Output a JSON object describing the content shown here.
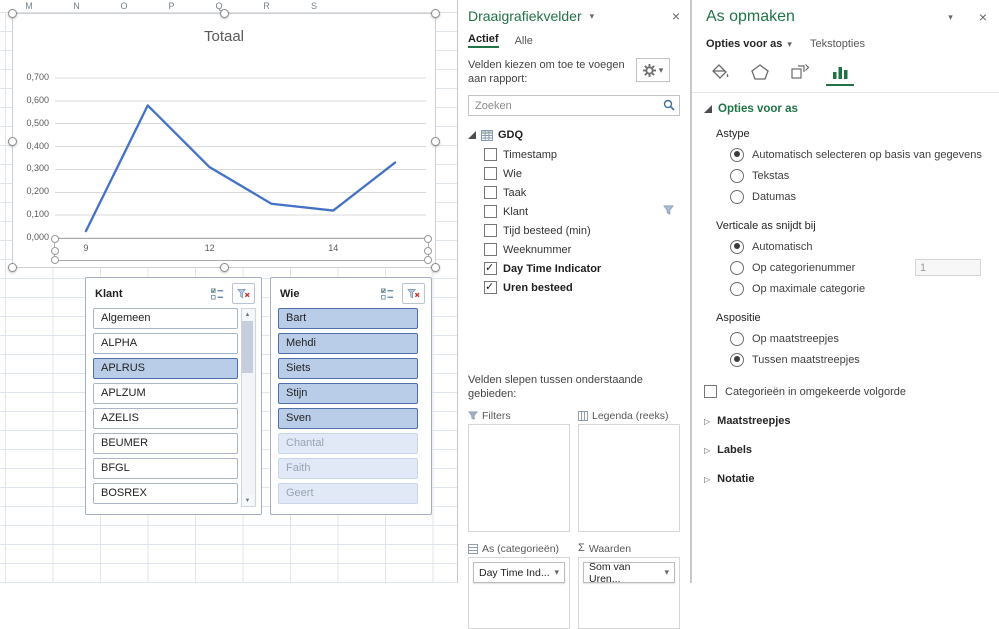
{
  "glyphs": {
    "close": "×",
    "caret": "▾",
    "collapsed": "▷",
    "sigma": "Σ",
    "up_arrow": "▲",
    "down_arrow": "▼"
  },
  "colors": {
    "accent_green": "#217346",
    "line_blue": "#4472C4"
  },
  "spreadsheet": {
    "column_headers": [
      "M",
      "N",
      "O",
      "P",
      "Q",
      "R",
      "S"
    ]
  },
  "chart_data": {
    "type": "line",
    "title": "Totaal",
    "categories": [
      "9",
      "",
      "12",
      "",
      "14",
      ""
    ],
    "values": [
      0.03,
      0.58,
      0.31,
      0.15,
      0.12,
      0.33
    ],
    "ylim": [
      0,
      0.7
    ],
    "ytick_labels": [
      "0,700",
      "0,600",
      "0,500",
      "0,400",
      "0,300",
      "0,200",
      "0,100",
      "0,000"
    ],
    "xtick_labels": [
      "9",
      "12",
      "14"
    ],
    "grid": true,
    "legend": "none",
    "line_color": "#4472C4"
  },
  "slicers": {
    "klant": {
      "title": "Klant",
      "items": [
        {
          "label": "Algemeen",
          "state": "unselected"
        },
        {
          "label": "ALPHA",
          "state": "unselected"
        },
        {
          "label": "APLRUS",
          "state": "selected"
        },
        {
          "label": "APLZUM",
          "state": "unselected"
        },
        {
          "label": "AZELIS",
          "state": "unselected"
        },
        {
          "label": "BEUMER",
          "state": "unselected"
        },
        {
          "label": "BFGL",
          "state": "unselected"
        },
        {
          "label": "BOSREX",
          "state": "unselected"
        }
      ]
    },
    "wie": {
      "title": "Wie",
      "items": [
        {
          "label": "Bart",
          "state": "selected"
        },
        {
          "label": "Mehdi",
          "state": "selected"
        },
        {
          "label": "Siets",
          "state": "selected"
        },
        {
          "label": "Stijn",
          "state": "selected"
        },
        {
          "label": "Sven",
          "state": "selected"
        },
        {
          "label": "Chantal",
          "state": "no-data"
        },
        {
          "label": "Faith",
          "state": "no-data"
        },
        {
          "label": "Geert",
          "state": "no-data"
        }
      ]
    }
  },
  "fields_panel": {
    "title": "Draaigrafiekvelder",
    "tabs": [
      "Actief",
      "Alle"
    ],
    "choose_fields_label": "Velden kiezen om toe te voegen aan rapport:",
    "search_placeholder": "Zoeken",
    "table_name": "GDQ",
    "fields": [
      {
        "label": "Timestamp",
        "checked": false
      },
      {
        "label": "Wie",
        "checked": false
      },
      {
        "label": "Taak",
        "checked": false
      },
      {
        "label": "Klant",
        "checked": false,
        "filtered": true
      },
      {
        "label": "Tijd besteed (min)",
        "checked": false
      },
      {
        "label": "Weeknummer",
        "checked": false
      },
      {
        "label": "Day Time Indicator",
        "checked": true
      },
      {
        "label": "Uren besteed",
        "checked": true
      }
    ],
    "drag_label": "Velden slepen tussen onderstaande gebieden:",
    "areas": {
      "filters": {
        "label": "Filters",
        "items": []
      },
      "legend": {
        "label": "Legenda (reeks)",
        "items": []
      },
      "axis": {
        "label": "As (categorieën)",
        "items": [
          "Day Time Ind..."
        ]
      },
      "values": {
        "label": "Waarden",
        "items": [
          "Som van Uren..."
        ]
      }
    }
  },
  "format_panel": {
    "title": "As opmaken",
    "tabs": [
      "Opties voor as",
      "Tekstopties"
    ],
    "icon_tabs": [
      "fill-line",
      "effects",
      "size-properties",
      "axis-options"
    ],
    "section": "Opties voor as",
    "groups": [
      {
        "label": "Astype",
        "options": [
          {
            "label": "Automatisch selecteren op basis van gegevens",
            "selected": true
          },
          {
            "label": "Tekstas",
            "selected": false
          },
          {
            "label": "Datumas",
            "selected": false
          }
        ]
      },
      {
        "label": "Verticale as snijdt bij",
        "options": [
          {
            "label": "Automatisch",
            "selected": true
          },
          {
            "label": "Op categorienummer",
            "selected": false,
            "input_value": "1"
          },
          {
            "label": "Op maximale categorie",
            "selected": false
          }
        ]
      },
      {
        "label": "Aspositie",
        "options": [
          {
            "label": "Op maatstreepjes",
            "selected": false
          },
          {
            "label": "Tussen maatstreepjes",
            "selected": true
          }
        ]
      }
    ],
    "checkbox": {
      "label": "Categorieën in omgekeerde volgorde",
      "checked": false
    },
    "collapsed_sections": [
      "Maatstreepjes",
      "Labels",
      "Notatie"
    ]
  }
}
